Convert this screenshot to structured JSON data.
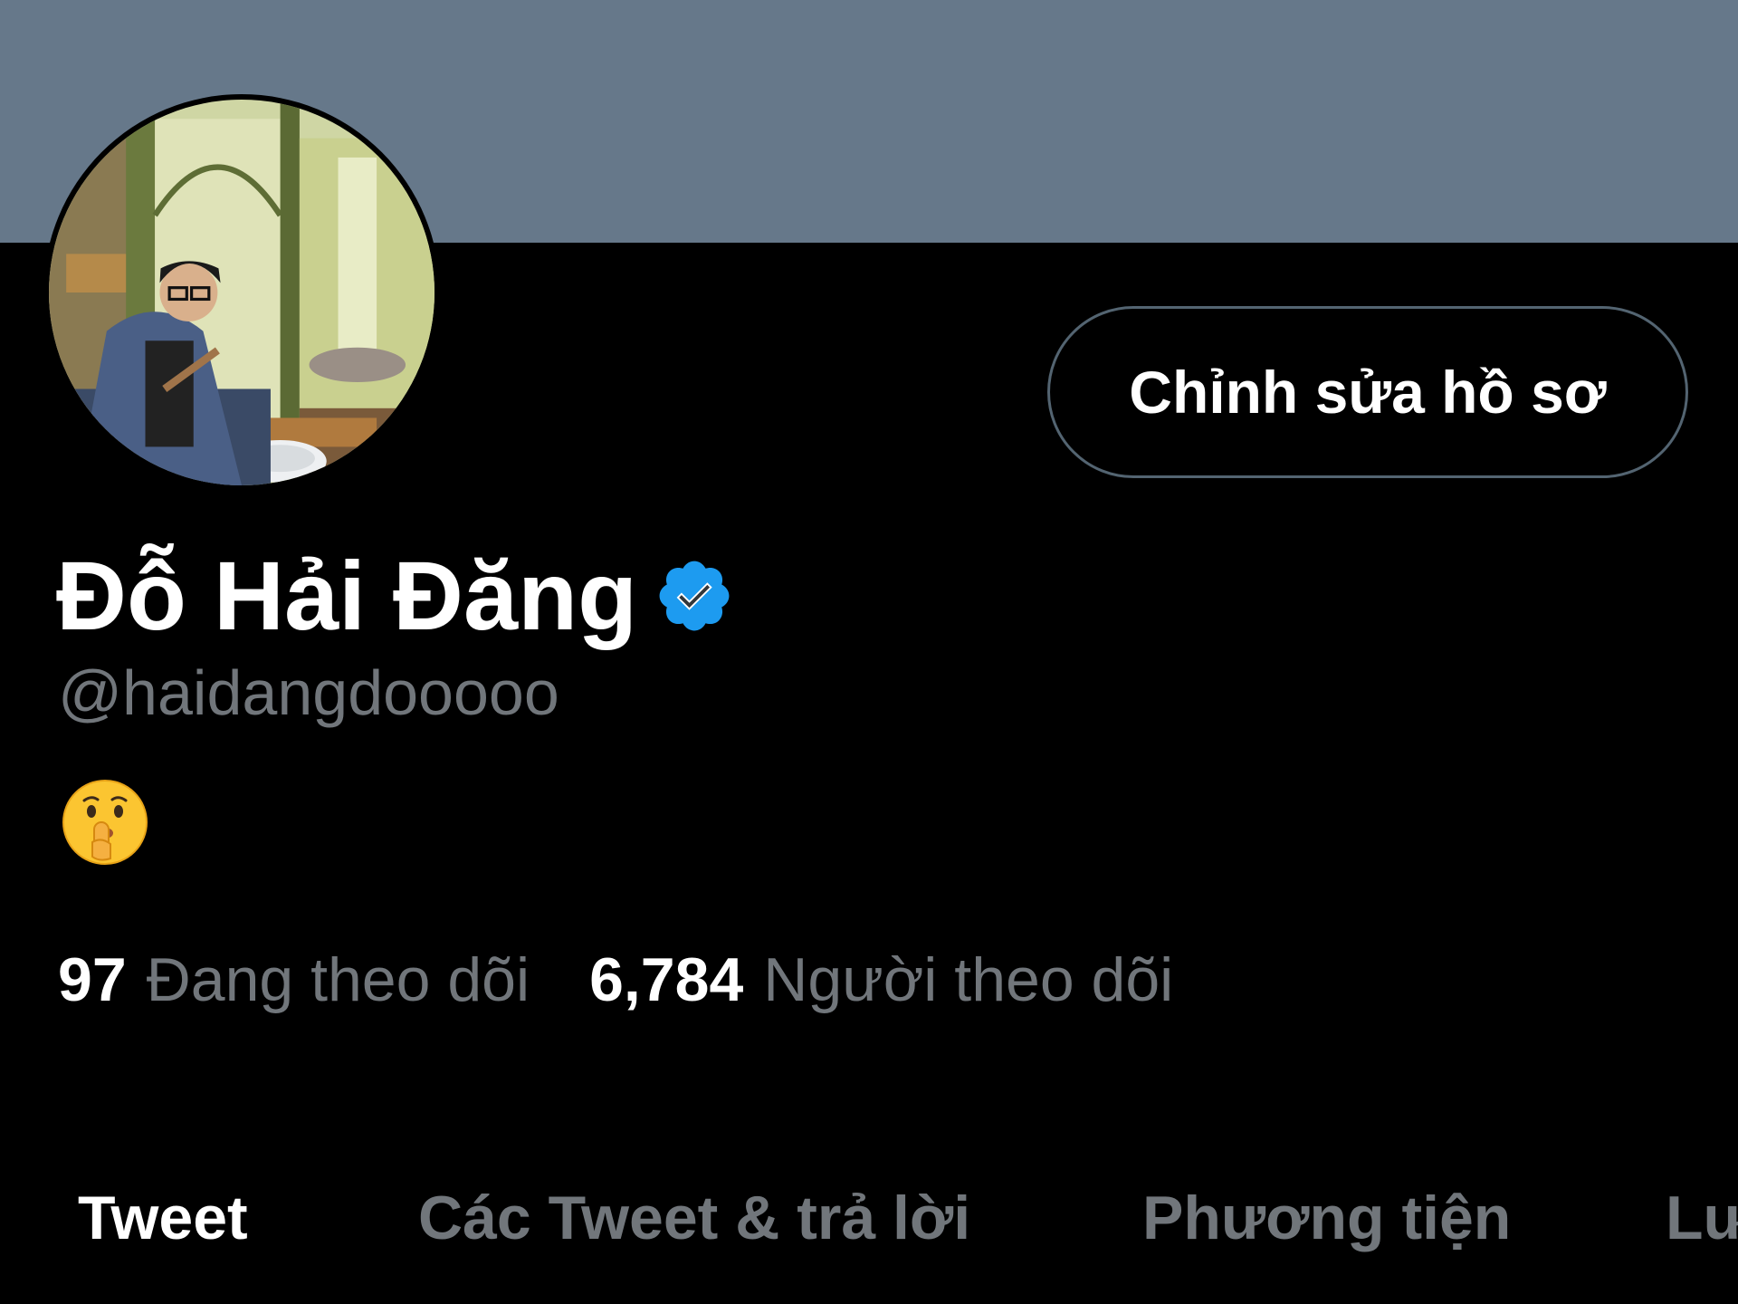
{
  "profile": {
    "display_name": "Đỗ Hải Đăng",
    "handle": "@haidangdooooo",
    "bio_emoji": "shushing-face-emoji",
    "verified_icon": "verified-badge-icon",
    "edit_button_label": "Chỉnh sửa hồ sơ"
  },
  "stats": {
    "following_count": "97",
    "following_label": "Đang theo dõi",
    "followers_count": "6,784",
    "followers_label": "Người theo dõi"
  },
  "tabs": [
    {
      "label": "Tweet",
      "active": true
    },
    {
      "label": "Các Tweet & trả lời",
      "active": false
    },
    {
      "label": "Phương tiện",
      "active": false
    },
    {
      "label": "Lư",
      "active": false
    }
  ],
  "colors": {
    "banner": "#66788a",
    "background": "#000000",
    "primary_text": "#ffffff",
    "secondary_text": "#71767b",
    "verified_blue": "#1d9bf0",
    "button_border": "#536471"
  }
}
